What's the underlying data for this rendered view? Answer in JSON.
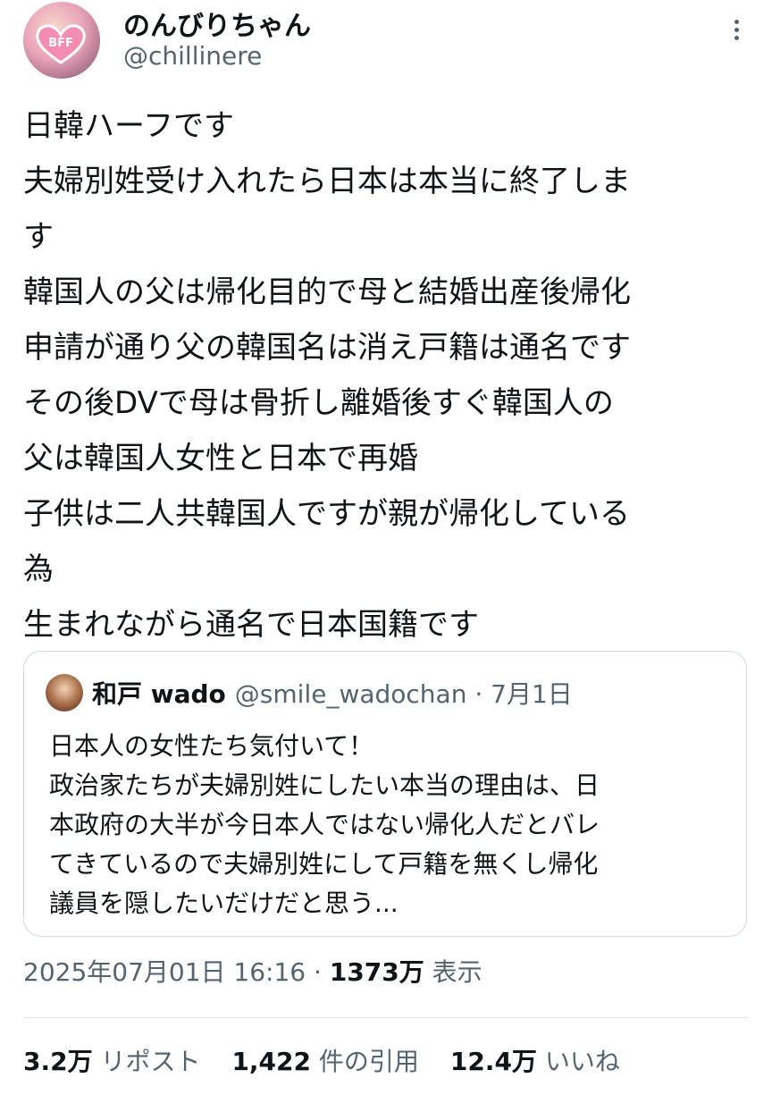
{
  "author": {
    "display_name": "のんびりちゃん",
    "handle": "@chillinere",
    "avatar_badge": "BFF"
  },
  "tweet": {
    "lines": [
      "日韓ハーフです",
      "夫婦別姓受け入れたら日本は本当に終了しま",
      "す",
      "韓国人の父は帰化目的で母と結婚出産後帰化",
      "申請が通り父の韓国名は消え戸籍は通名です",
      "その後DVで母は骨折し離婚後すぐ韓国人の",
      "父は韓国人女性と日本で再婚",
      "子供は二人共韓国人ですが親が帰化している",
      "為",
      "生まれながら通名で日本国籍です"
    ]
  },
  "quote": {
    "display_name": "和戸 wado",
    "handle_date": "@smile_wadochan · 7月1日",
    "lines": [
      "日本人の女性たち気付いて！",
      "政治家たちが夫婦別姓にしたい本当の理由は、日",
      "本政府の大半が今日本人ではない帰化人だとバレ",
      "てきているので夫婦別姓にして戸籍を無くし帰化",
      "議員を隠したいだけだと思う..."
    ]
  },
  "meta": {
    "timestamp": "2025年07月01日 16:16 · ",
    "views_count": "1373万",
    "views_label": " 表示"
  },
  "stats": {
    "reposts_count": "3.2万",
    "reposts_label": "リポスト",
    "quotes_count": "1,422",
    "quotes_label": "件の引用",
    "likes_count": "12.4万",
    "likes_label": "いいね"
  },
  "colors": {
    "text": "#0f1419",
    "secondary": "#536471",
    "border": "#cfd9de"
  },
  "icons": [
    "more-options-icon"
  ]
}
